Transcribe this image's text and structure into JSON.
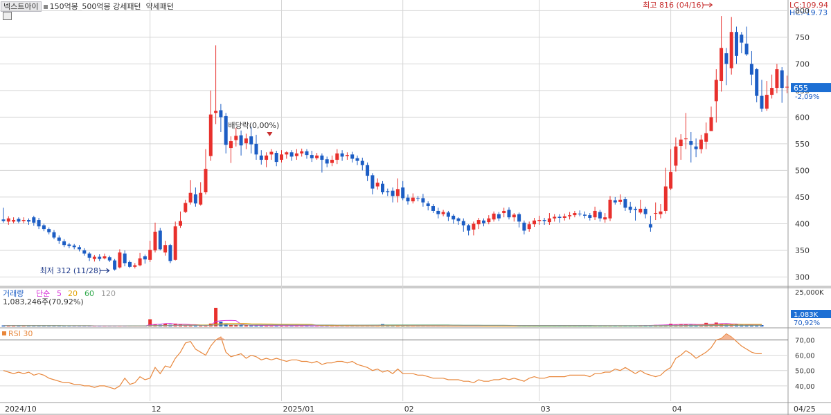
{
  "header": {
    "stock_name": "넥스트아이",
    "pattern_1": "150억봉_500억봉 강세패턴",
    "pattern_2": "약세패턴",
    "lc_label": "LC:109.94",
    "hc_label": "HC:-19.73"
  },
  "colors": {
    "up": "#e8302c",
    "down": "#1c5dc4",
    "rsi": "#e8863a",
    "grid": "#d6d6d6",
    "ma5": "#d62fd6",
    "ma20": "#e0a000",
    "ma60": "#2ea84a",
    "ma120": "#999999"
  },
  "chart_data": [
    {
      "type": "candlestick",
      "name": "price",
      "ylim": [
        285,
        820
      ],
      "y_ticks": [
        "800",
        "750",
        "700",
        "650",
        "600",
        "550",
        "500",
        "450",
        "400",
        "350",
        "300"
      ],
      "y_tick_values": [
        800,
        750,
        700,
        650,
        600,
        550,
        500,
        450,
        400,
        350,
        300
      ],
      "x_labels": [
        "2024/10",
        "12",
        "2025/01",
        "02",
        "03",
        "04",
        "04/25"
      ],
      "x_label_index": [
        0,
        29,
        55,
        79,
        106,
        132,
        155
      ],
      "candles": [
        [
          408,
          405,
          430,
          402
        ],
        [
          404,
          410,
          414,
          398
        ],
        [
          404,
          407,
          412,
          401
        ],
        [
          409,
          404,
          412,
          401
        ],
        [
          405,
          407,
          412,
          401
        ],
        [
          407,
          404,
          410,
          398
        ],
        [
          412,
          402,
          415,
          396
        ],
        [
          407,
          395,
          411,
          390
        ],
        [
          397,
          390,
          400,
          386
        ],
        [
          390,
          384,
          393,
          380
        ],
        [
          384,
          374,
          388,
          371
        ],
        [
          374,
          368,
          378,
          362
        ],
        [
          367,
          360,
          371,
          356
        ],
        [
          361,
          358,
          364,
          354
        ],
        [
          359,
          356,
          362,
          352
        ],
        [
          356,
          352,
          360,
          348
        ],
        [
          350,
          344,
          354,
          340
        ],
        [
          344,
          336,
          347,
          330
        ],
        [
          334,
          338,
          341,
          329
        ],
        [
          338,
          334,
          343,
          330
        ],
        [
          335,
          339,
          344,
          333
        ],
        [
          337,
          331,
          340,
          328
        ],
        [
          331,
          314,
          334,
          312
        ],
        [
          318,
          346,
          352,
          316
        ],
        [
          344,
          326,
          350,
          320
        ],
        [
          328,
          319,
          331,
          317
        ],
        [
          319,
          322,
          326,
          316
        ],
        [
          322,
          335,
          345,
          320
        ],
        [
          339,
          333,
          342,
          325
        ],
        [
          332,
          351,
          368,
          328
        ],
        [
          350,
          385,
          402,
          346
        ],
        [
          387,
          352,
          392,
          350
        ],
        [
          346,
          360,
          368,
          340
        ],
        [
          360,
          330,
          362,
          326
        ],
        [
          332,
          395,
          404,
          331
        ],
        [
          396,
          405,
          423,
          392
        ],
        [
          422,
          439,
          445,
          420
        ],
        [
          440,
          458,
          482,
          436
        ],
        [
          455,
          438,
          468,
          432
        ],
        [
          436,
          458,
          478,
          434
        ],
        [
          459,
          503,
          540,
          455
        ],
        [
          527,
          605,
          650,
          518
        ],
        [
          608,
          612,
          735,
          587
        ],
        [
          613,
          600,
          625,
          572
        ],
        [
          602,
          548,
          608,
          532
        ],
        [
          542,
          555,
          564,
          514
        ],
        [
          557,
          565,
          580,
          545
        ],
        [
          566,
          547,
          575,
          528
        ],
        [
          551,
          560,
          569,
          540
        ],
        [
          564,
          549,
          582,
          532
        ],
        [
          550,
          530,
          567,
          520
        ],
        [
          528,
          520,
          538,
          511
        ],
        [
          520,
          528,
          534,
          506
        ],
        [
          530,
          535,
          540,
          520
        ],
        [
          533,
          516,
          537,
          508
        ],
        [
          520,
          530,
          538,
          515
        ],
        [
          530,
          534,
          536,
          522
        ],
        [
          534,
          526,
          538,
          518
        ],
        [
          527,
          532,
          540,
          520
        ],
        [
          532,
          536,
          541,
          526
        ],
        [
          536,
          529,
          540,
          522
        ],
        [
          529,
          523,
          537,
          516
        ],
        [
          523,
          528,
          533,
          520
        ],
        [
          528,
          520,
          532,
          496
        ],
        [
          521,
          513,
          526,
          506
        ],
        [
          514,
          520,
          528,
          508
        ],
        [
          520,
          532,
          540,
          512
        ],
        [
          532,
          526,
          538,
          518
        ],
        [
          527,
          529,
          534,
          520
        ],
        [
          530,
          522,
          535,
          515
        ],
        [
          523,
          518,
          528,
          510
        ],
        [
          518,
          510,
          524,
          500
        ],
        [
          510,
          490,
          515,
          480
        ],
        [
          491,
          466,
          495,
          455
        ],
        [
          470,
          477,
          485,
          464
        ],
        [
          475,
          459,
          480,
          455
        ],
        [
          461,
          459,
          466,
          452
        ],
        [
          462,
          452,
          468,
          440
        ],
        [
          452,
          465,
          485,
          440
        ],
        [
          468,
          448,
          480,
          444
        ],
        [
          449,
          442,
          455,
          436
        ],
        [
          442,
          449,
          457,
          438
        ],
        [
          448,
          447,
          452,
          442
        ],
        [
          448,
          440,
          456,
          432
        ],
        [
          438,
          433,
          442,
          425
        ],
        [
          433,
          424,
          437,
          420
        ],
        [
          424,
          418,
          430,
          410
        ],
        [
          418,
          422,
          426,
          414
        ],
        [
          421,
          413,
          424,
          405
        ],
        [
          415,
          408,
          418,
          400
        ],
        [
          410,
          405,
          412,
          398
        ],
        [
          405,
          397,
          410,
          385
        ],
        [
          397,
          387,
          399,
          378
        ],
        [
          389,
          400,
          404,
          378
        ],
        [
          399,
          407,
          411,
          390
        ],
        [
          406,
          401,
          410,
          395
        ],
        [
          403,
          410,
          416,
          399
        ],
        [
          408,
          419,
          423,
          404
        ],
        [
          418,
          410,
          422,
          405
        ],
        [
          420,
          424,
          430,
          412
        ],
        [
          426,
          412,
          431,
          408
        ],
        [
          412,
          417,
          420,
          404
        ],
        [
          418,
          404,
          421,
          393
        ],
        [
          402,
          387,
          406,
          380
        ],
        [
          390,
          399,
          404,
          385
        ],
        [
          399,
          406,
          411,
          394
        ],
        [
          405,
          407,
          415,
          398
        ],
        [
          407,
          405,
          411,
          398
        ],
        [
          403,
          410,
          420,
          398
        ],
        [
          410,
          413,
          418,
          404
        ],
        [
          413,
          411,
          418,
          402
        ],
        [
          411,
          414,
          419,
          406
        ],
        [
          414,
          416,
          422,
          408
        ],
        [
          416,
          420,
          424,
          412
        ],
        [
          419,
          418,
          425,
          414
        ],
        [
          417,
          415,
          423,
          410
        ],
        [
          416,
          411,
          420,
          406
        ],
        [
          412,
          424,
          432,
          407
        ],
        [
          422,
          410,
          426,
          404
        ],
        [
          408,
          412,
          420,
          402
        ],
        [
          410,
          445,
          452,
          405
        ],
        [
          444,
          440,
          450,
          436
        ],
        [
          441,
          445,
          455,
          436
        ],
        [
          446,
          430,
          450,
          424
        ],
        [
          432,
          426,
          441,
          420
        ],
        [
          428,
          426,
          432,
          406
        ],
        [
          421,
          428,
          445,
          418
        ],
        [
          428,
          418,
          432,
          410
        ],
        [
          399,
          393,
          415,
          385
        ],
        [
          420,
          420,
          440,
          407
        ],
        [
          418,
          423,
          437,
          410
        ],
        [
          424,
          470,
          505,
          419
        ],
        [
          466,
          497,
          540,
          463
        ],
        [
          509,
          545,
          562,
          498
        ],
        [
          546,
          558,
          568,
          520
        ],
        [
          560,
          560,
          608,
          540
        ],
        [
          555,
          548,
          572,
          515
        ],
        [
          545,
          540,
          560,
          525
        ],
        [
          540,
          558,
          567,
          532
        ],
        [
          554,
          570,
          590,
          540
        ],
        [
          574,
          600,
          620,
          590
        ],
        [
          630,
          670,
          690,
          590
        ],
        [
          668,
          730,
          790,
          648
        ],
        [
          720,
          700,
          730,
          660
        ],
        [
          692,
          760,
          788,
          680
        ],
        [
          760,
          715,
          770,
          700
        ],
        [
          755,
          740,
          760,
          720
        ],
        [
          738,
          718,
          770,
          715
        ],
        [
          700,
          680,
          724,
          660
        ],
        [
          690,
          640,
          692,
          628
        ],
        [
          640,
          616,
          670,
          610
        ],
        [
          616,
          642,
          668,
          612
        ],
        [
          642,
          655,
          680,
          635
        ],
        [
          655,
          690,
          700,
          645
        ],
        [
          688,
          655,
          694,
          627
        ],
        [
          656,
          657,
          678,
          645
        ]
      ],
      "annotations": [
        {
          "text": "최고 816 (04/16)",
          "at_index": 141,
          "value": 816,
          "color": "#c83030"
        },
        {
          "text": "최저 312 (11/28)",
          "at_index": 22,
          "value": 312,
          "color": "#1f3a8a"
        },
        {
          "text": "배당락(0,00%)",
          "at_index": 48,
          "value": 585,
          "color": "#333333"
        }
      ],
      "current_price": "655",
      "current_change": "-2,09%"
    },
    {
      "type": "bar",
      "name": "volume",
      "series_label": "거래량",
      "ma_legend": [
        "단순",
        "5",
        "20",
        "60",
        "120"
      ],
      "info_text": "1,083,246주(70,92%)",
      "y_tick": "25,000K",
      "current_label": "1,083K",
      "current_pct": "70,92%",
      "ylim": [
        0,
        27000
      ],
      "values": [
        750,
        700,
        650,
        620,
        600,
        580,
        560,
        540,
        520,
        510,
        500,
        480,
        460,
        440,
        420,
        410,
        400,
        380,
        370,
        360,
        350,
        340,
        330,
        320,
        310,
        300,
        300,
        300,
        310,
        5200,
        1500,
        1200,
        2000,
        1300,
        2100,
        1500,
        1100,
        900,
        800,
        700,
        600,
        2100,
        13500,
        3500,
        1800,
        1200,
        1000,
        900,
        800,
        700,
        650,
        600,
        580,
        560,
        540,
        520,
        500,
        490,
        480,
        470,
        460,
        450,
        440,
        430,
        420,
        410,
        400,
        390,
        380,
        370,
        360,
        350,
        340,
        330,
        320,
        1700,
        600,
        500,
        400,
        350,
        340,
        330,
        320,
        310,
        300,
        290,
        280,
        270,
        260,
        250,
        250,
        250,
        250,
        260,
        270,
        280,
        290,
        300,
        310,
        320,
        330,
        340,
        350,
        360,
        370,
        380,
        390,
        400,
        410,
        420,
        430,
        440,
        450,
        460,
        470,
        480,
        490,
        500,
        500,
        500,
        500,
        500,
        500,
        500,
        500,
        600,
        800,
        900,
        1000,
        1100,
        1200,
        1300,
        2000,
        1500,
        1800,
        1600,
        1400,
        1300,
        1200,
        2600,
        1500,
        2800,
        2000,
        1500,
        1400,
        1300,
        1200,
        1100,
        1100,
        1083,
        1000
      ]
    },
    {
      "type": "line",
      "name": "rsi",
      "series_label": "RSI 30",
      "ylim": [
        30,
        77
      ],
      "y_ticks": [
        "70,00",
        "60,00",
        "50,00",
        "40,00"
      ],
      "y_tick_values": [
        70,
        60,
        50,
        40
      ],
      "values": [
        50,
        49,
        48,
        49,
        48,
        49,
        47,
        48,
        47,
        45,
        44,
        43,
        42,
        42,
        41,
        41,
        40,
        40,
        39,
        40,
        40,
        39,
        38,
        40,
        45,
        41,
        42,
        46,
        44,
        45,
        52,
        48,
        53,
        52,
        58,
        62,
        68,
        69,
        64,
        62,
        60,
        66,
        70,
        72,
        62,
        59,
        60,
        61,
        58,
        60,
        59,
        57,
        58,
        57,
        58,
        57,
        56,
        57,
        57,
        56,
        56,
        55,
        56,
        54,
        55,
        55,
        56,
        56,
        55,
        56,
        54,
        53,
        52,
        50,
        51,
        49,
        50,
        48,
        51,
        48,
        48,
        48,
        47,
        47,
        46,
        45,
        45,
        45,
        44,
        44,
        44,
        43,
        43,
        42,
        44,
        43,
        43,
        44,
        44,
        45,
        44,
        45,
        44,
        43,
        45,
        46,
        45,
        45,
        46,
        46,
        46,
        46,
        47,
        47,
        47,
        47,
        46,
        48,
        48,
        49,
        49,
        51,
        50,
        52,
        50,
        48,
        50,
        48,
        47,
        46,
        47,
        50,
        52,
        58,
        60,
        63,
        61,
        58,
        60,
        62,
        65,
        70,
        71,
        74,
        72,
        69,
        66,
        64,
        62,
        61,
        61
      ]
    }
  ]
}
